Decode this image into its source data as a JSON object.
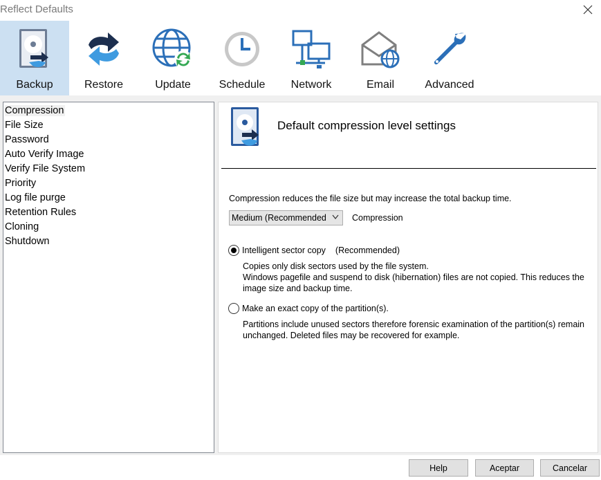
{
  "window": {
    "title": "Reflect Defaults",
    "close_icon": "close-icon"
  },
  "toolbar": {
    "items": [
      {
        "label": "Backup",
        "icon": "backup-disk-icon",
        "active": true
      },
      {
        "label": "Restore",
        "icon": "restore-arrows-icon",
        "active": false
      },
      {
        "label": "Update",
        "icon": "update-globe-icon",
        "active": false
      },
      {
        "label": "Schedule",
        "icon": "clock-icon",
        "active": false
      },
      {
        "label": "Network",
        "icon": "network-computers-icon",
        "active": false
      },
      {
        "label": "Email",
        "icon": "email-envelope-icon",
        "active": false
      },
      {
        "label": "Advanced",
        "icon": "wrench-icon",
        "active": false
      }
    ]
  },
  "sidebar": {
    "items": [
      {
        "label": "Compression",
        "selected": true
      },
      {
        "label": "File Size"
      },
      {
        "label": "Password"
      },
      {
        "label": "Auto Verify Image"
      },
      {
        "label": "Verify File System"
      },
      {
        "label": "Priority"
      },
      {
        "label": "Log file purge"
      },
      {
        "label": "Retention Rules"
      },
      {
        "label": "Cloning"
      },
      {
        "label": "Shutdown"
      }
    ]
  },
  "panel": {
    "title": "Default compression level settings",
    "description": "Compression reduces the file size but may increase the total backup time.",
    "compression_select": {
      "value": "Medium (Recommended",
      "label": "Compression"
    },
    "options": [
      {
        "label": "Intelligent sector copy",
        "recommended": "(Recommended)",
        "checked": true,
        "notes": [
          "Copies only disk sectors used by the file system.",
          "Windows pagefile and suspend to disk (hibernation) files are not copied. This reduces the image size and backup time."
        ]
      },
      {
        "label": "Make an exact copy of the partition(s).",
        "recommended": "",
        "checked": false,
        "notes": [
          "Partitions include unused sectors therefore forensic examination of the partition(s) remain unchanged. Deleted files may be recovered for example."
        ]
      }
    ]
  },
  "buttons": {
    "help": "Help",
    "accept": "Aceptar",
    "cancel": "Cancelar"
  },
  "colors": {
    "accent_blue": "#2b7bd0",
    "active_tab_bg": "#cce0f2",
    "dark_icon": "#1f3a5f",
    "panel_bg": "#f0f0f0"
  }
}
